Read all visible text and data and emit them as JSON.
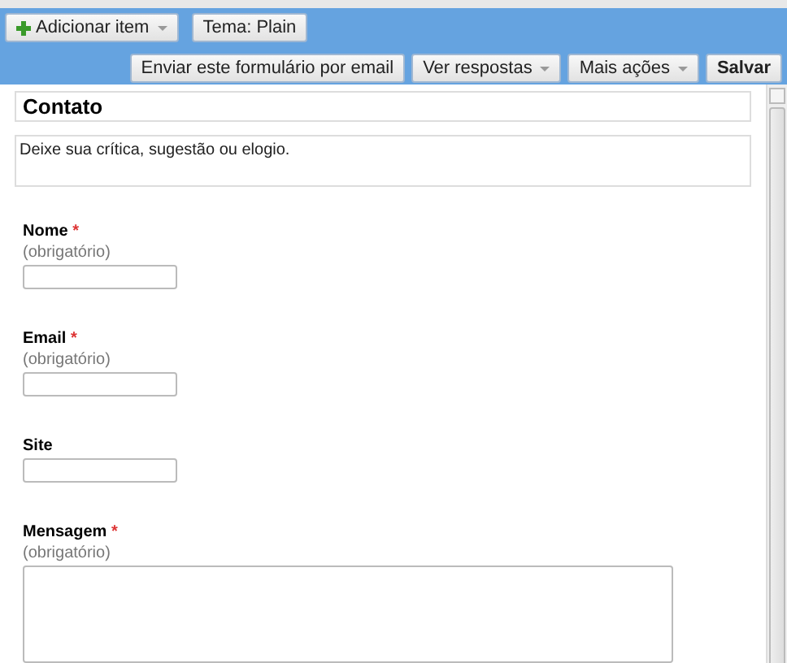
{
  "toolbar": {
    "top_buttons": [
      {
        "label": "Adicionar item",
        "kind": "add-menu"
      },
      {
        "label": "Tema:  Plain",
        "kind": "plain"
      }
    ],
    "bottom_buttons": [
      {
        "label": "Enviar este formulário por email",
        "kind": "plain"
      },
      {
        "label": "Ver respostas",
        "kind": "menu"
      },
      {
        "label": "Mais ações",
        "kind": "menu"
      },
      {
        "label": "Salvar",
        "kind": "primary"
      }
    ]
  },
  "form": {
    "title": "Contato",
    "description": "Deixe sua crítica, sugestão ou elogio.",
    "fields": [
      {
        "label": "Nome",
        "required_mark": "*",
        "hint": "(obrigatório)",
        "kind": "text"
      },
      {
        "label": "Email",
        "required_mark": "*",
        "hint": "(obrigatório)",
        "kind": "text"
      },
      {
        "label": "Site",
        "kind": "text"
      },
      {
        "label": "Mensagem",
        "required_mark": "*",
        "hint": "(obrigatório)",
        "kind": "textarea"
      }
    ]
  }
}
